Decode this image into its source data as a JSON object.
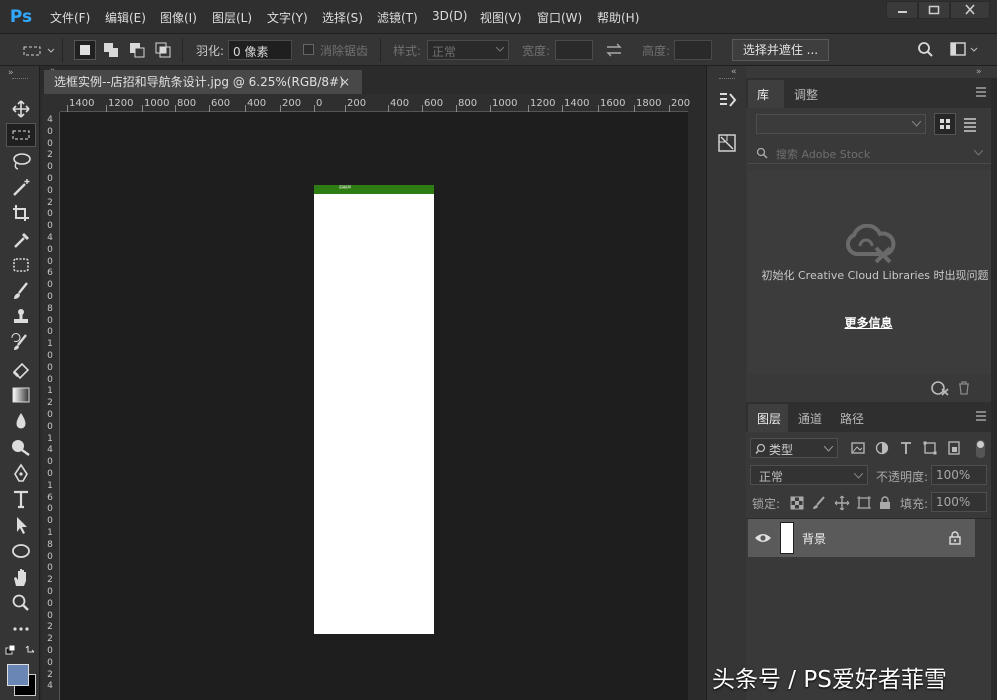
{
  "app": {
    "logo": "Ps"
  },
  "menu": [
    "文件(F)",
    "编辑(E)",
    "图像(I)",
    "图层(L)",
    "文字(Y)",
    "选择(S)",
    "滤镜(T)",
    "3D(D)",
    "视图(V)",
    "窗口(W)",
    "帮助(H)"
  ],
  "options": {
    "feather_label": "羽化:",
    "feather_value": "0 像素",
    "antialias_label": "消除锯齿",
    "style_label": "样式:",
    "style_value": "正常",
    "width_label": "宽度:",
    "height_label": "高度:",
    "select_mask_button": "选择并遮住 ..."
  },
  "document": {
    "tab_title": "选框实例--店招和导航条设计.jpg @ 6.25%(RGB/8#)",
    "close_glyph": "×",
    "banner_text": "店铺名称"
  },
  "ruler": {
    "h_ticks": [
      "1400",
      "1200",
      "1000",
      "800",
      "600",
      "400",
      "200",
      "0",
      "200",
      "400",
      "600",
      "800",
      "1000",
      "1200",
      "1400",
      "1600",
      "1800",
      "200"
    ],
    "v_ticks": [
      "4",
      "0",
      "0",
      "2",
      "0",
      "0",
      "0",
      "2",
      "0",
      "0",
      "4",
      "0",
      "0",
      "6",
      "0",
      "0",
      "8",
      "0",
      "0",
      "1",
      "0",
      "0",
      "0",
      "1",
      "2",
      "0",
      "0",
      "1",
      "4",
      "0",
      "0",
      "1",
      "6",
      "0",
      "0",
      "1",
      "8",
      "0",
      "0",
      "2",
      "0",
      "0",
      "0",
      "2",
      "2",
      "0",
      "0",
      "2",
      "4"
    ]
  },
  "library": {
    "tab_library": "库",
    "tab_adjust": "调整",
    "search_placeholder": "搜索 Adobe Stock",
    "init_message": "初始化 Creative Cloud Libraries 时出现问题",
    "more_info": "更多信息"
  },
  "layers": {
    "tab_layers": "图层",
    "tab_channels": "通道",
    "tab_paths": "路径",
    "filter_kind": "类型",
    "blend_mode": "正常",
    "opacity_label": "不透明度:",
    "opacity_value": "100%",
    "lock_label": "锁定:",
    "fill_label": "填充:",
    "fill_value": "100%",
    "items": [
      {
        "name": "背景"
      }
    ]
  },
  "watermark": "头条号 / PS爱好者菲雪",
  "colors": {
    "accent": "#31a8ff",
    "banner_green": "#2e7d12",
    "foreground": "#6a86b5"
  }
}
